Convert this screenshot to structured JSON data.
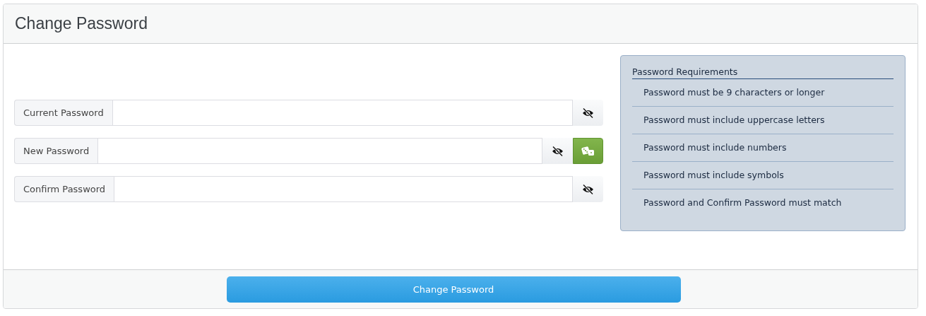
{
  "header": {
    "title": "Change Password"
  },
  "fields": [
    {
      "label": "Current Password",
      "buttons": [
        {
          "kind": "toggle-visibility"
        }
      ]
    },
    {
      "label": "New Password",
      "buttons": [
        {
          "kind": "toggle-visibility"
        },
        {
          "kind": "generate"
        }
      ]
    },
    {
      "label": "Confirm Password",
      "buttons": [
        {
          "kind": "toggle-visibility"
        }
      ]
    }
  ],
  "requirements": {
    "title": "Password Requirements",
    "items": [
      "Password must be 9 characters or longer",
      "Password must include uppercase letters",
      "Password must include numbers",
      "Password must include symbols",
      "Password and Confirm Password must match"
    ]
  },
  "footer": {
    "submit": "Change Password"
  }
}
